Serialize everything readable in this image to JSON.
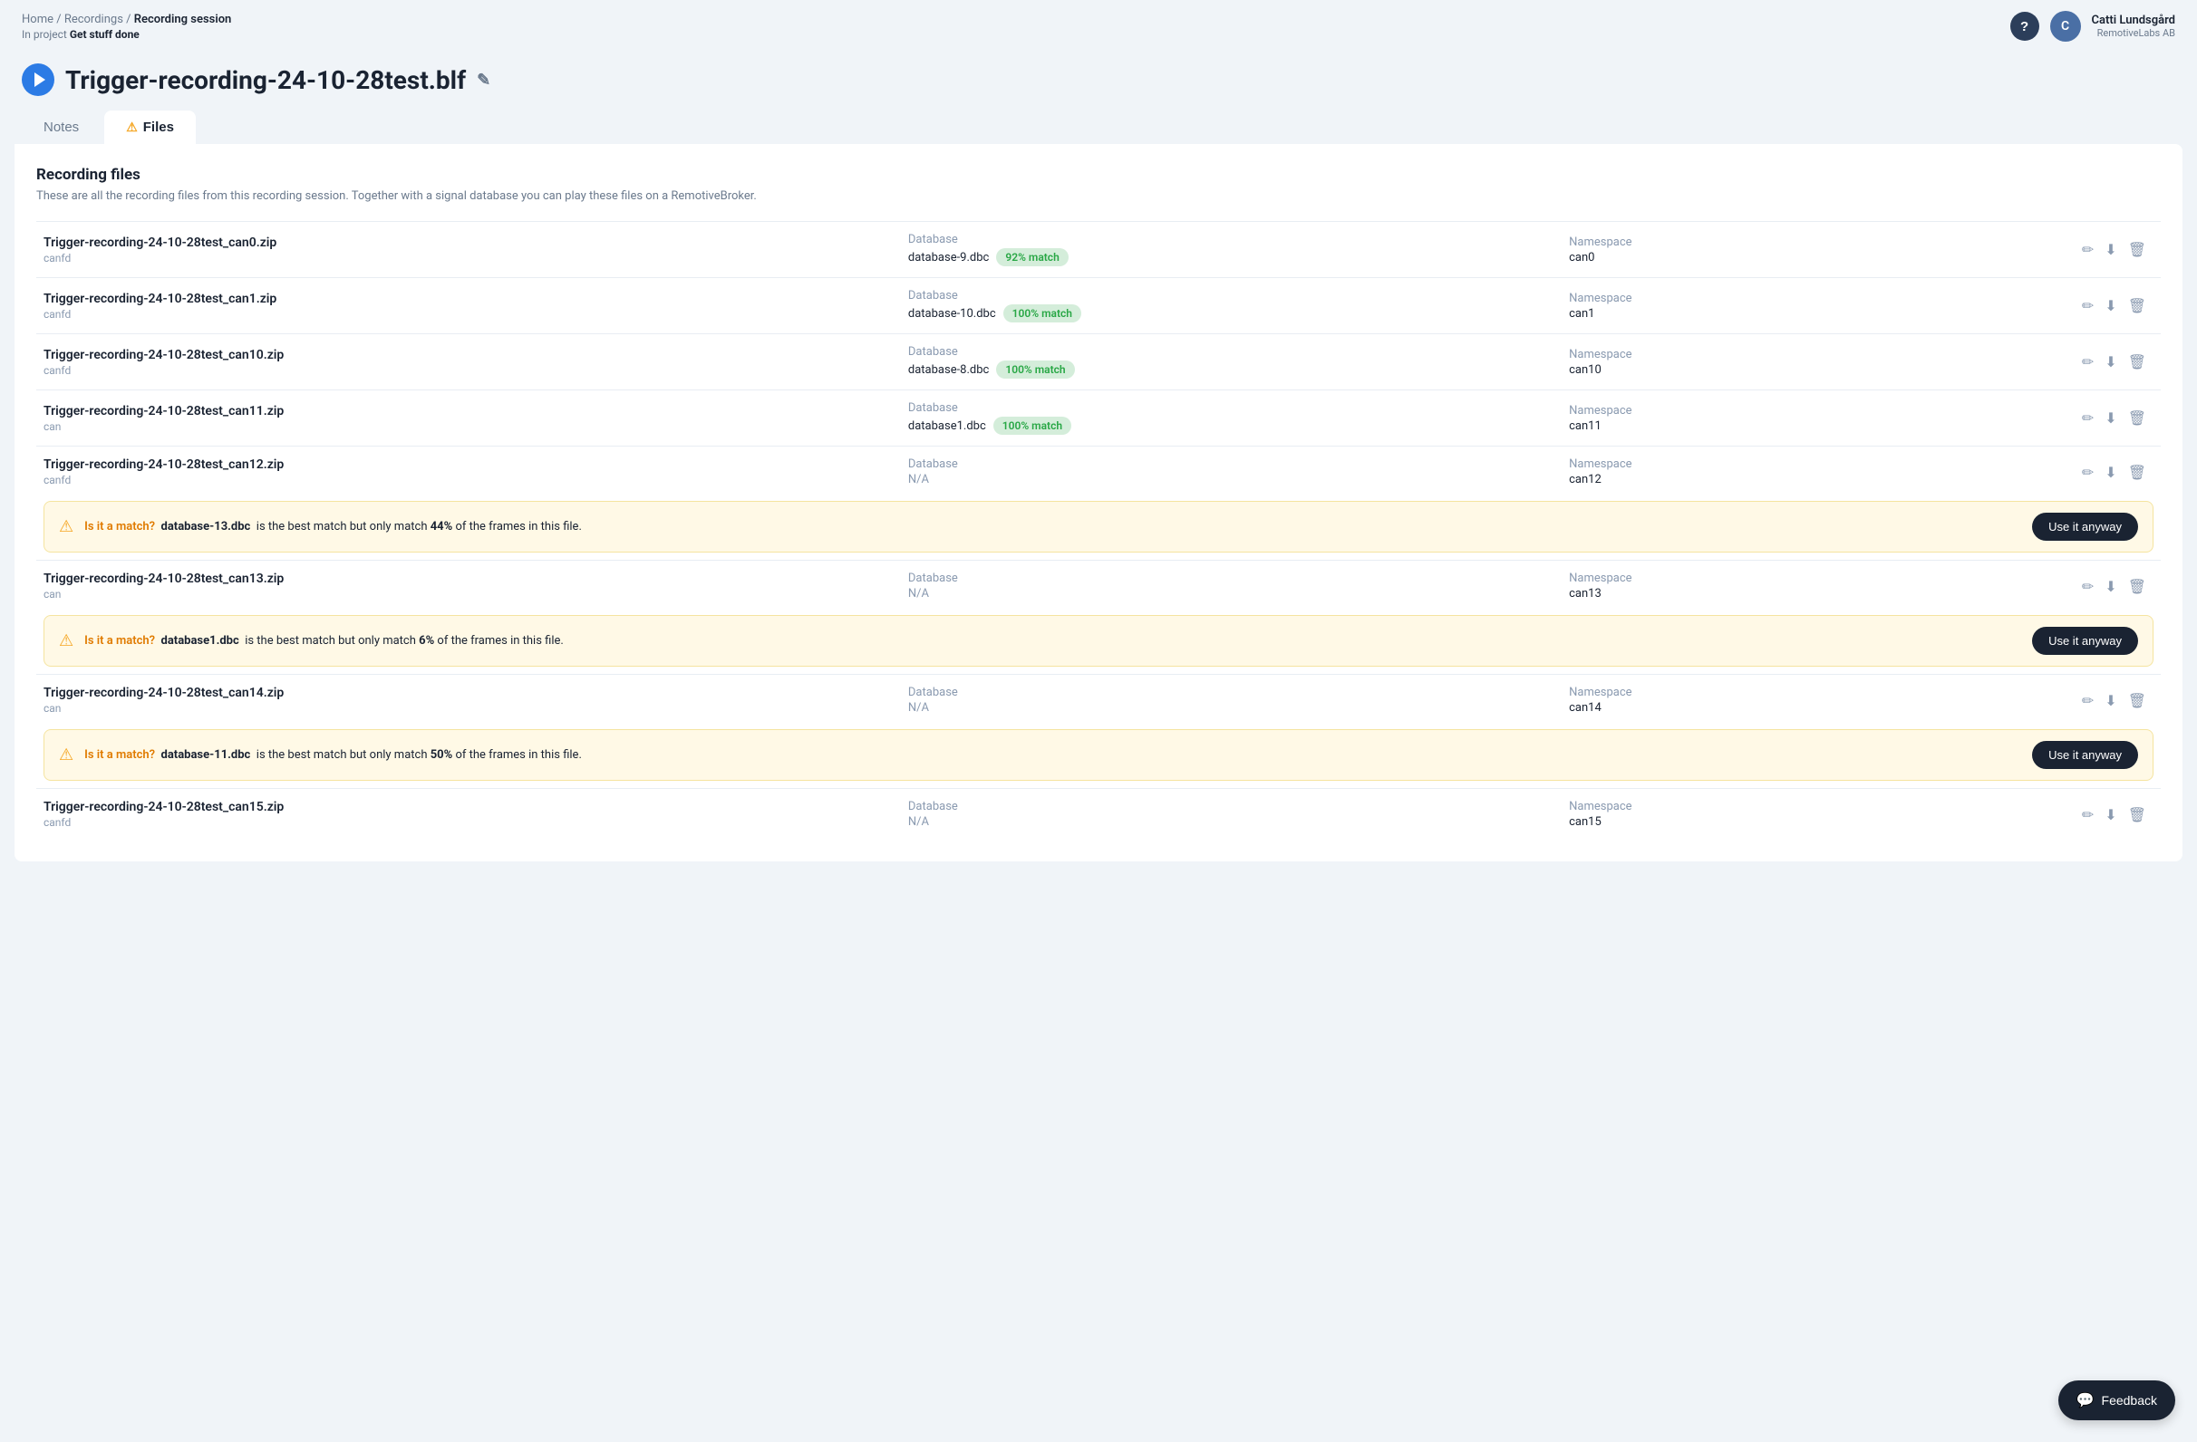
{
  "breadcrumb": {
    "home": "Home",
    "recordings": "Recordings",
    "current": "Recording session",
    "project_prefix": "In project",
    "project_name": "Get stuff done"
  },
  "user": {
    "name": "Catti Lundsgård",
    "company": "RemotiveLabs AB",
    "initials": "C"
  },
  "page": {
    "title": "Trigger-recording-24-10-28test.blf",
    "edit_icon": "✎"
  },
  "tabs": [
    {
      "id": "notes",
      "label": "Notes",
      "active": false,
      "warning": false
    },
    {
      "id": "files",
      "label": "Files",
      "active": true,
      "warning": true
    }
  ],
  "section": {
    "title": "Recording files",
    "description": "These are all the recording files from this recording session. Together with a signal database you can play these files on a RemotiveBroker."
  },
  "files": [
    {
      "name": "Trigger-recording-24-10-28test_can0.zip",
      "type": "canfd",
      "database_label": "Database",
      "database_value": "database-9.dbc",
      "match": "92% match",
      "match_class": "match-92",
      "namespace_label": "Namespace",
      "namespace_value": "can0",
      "has_warning": false
    },
    {
      "name": "Trigger-recording-24-10-28test_can1.zip",
      "type": "canfd",
      "database_label": "Database",
      "database_value": "database-10.dbc",
      "match": "100% match",
      "match_class": "match-100",
      "namespace_label": "Namespace",
      "namespace_value": "can1",
      "has_warning": false
    },
    {
      "name": "Trigger-recording-24-10-28test_can10.zip",
      "type": "canfd",
      "database_label": "Database",
      "database_value": "database-8.dbc",
      "match": "100% match",
      "match_class": "match-100",
      "namespace_label": "Namespace",
      "namespace_value": "can10",
      "has_warning": false
    },
    {
      "name": "Trigger-recording-24-10-28test_can11.zip",
      "type": "can",
      "database_label": "Database",
      "database_value": "database1.dbc",
      "match": "100% match",
      "match_class": "match-100",
      "namespace_label": "Namespace",
      "namespace_value": "can11",
      "has_warning": false
    },
    {
      "name": "Trigger-recording-24-10-28test_can12.zip",
      "type": "canfd",
      "database_label": "Database",
      "database_value": "N/A",
      "match": null,
      "match_class": null,
      "namespace_label": "Namespace",
      "namespace_value": "can12",
      "has_warning": true,
      "warning": {
        "best_match_db": "database-13.dbc",
        "match_percent": "44%",
        "button_label": "Use it anyway"
      }
    },
    {
      "name": "Trigger-recording-24-10-28test_can13.zip",
      "type": "can",
      "database_label": "Database",
      "database_value": "N/A",
      "match": null,
      "match_class": null,
      "namespace_label": "Namespace",
      "namespace_value": "can13",
      "has_warning": true,
      "warning": {
        "best_match_db": "database1.dbc",
        "match_percent": "6%",
        "button_label": "Use it anyway"
      }
    },
    {
      "name": "Trigger-recording-24-10-28test_can14.zip",
      "type": "can",
      "database_label": "Database",
      "database_value": "N/A",
      "match": null,
      "match_class": null,
      "namespace_label": "Namespace",
      "namespace_value": "can14",
      "has_warning": true,
      "warning": {
        "best_match_db": "database-11.dbc",
        "match_percent": "50%",
        "button_label": "Use it anyway"
      }
    },
    {
      "name": "Trigger-recording-24-10-28test_can15.zip",
      "type": "canfd",
      "database_label": "Database",
      "database_value": "N/A",
      "match": null,
      "match_class": null,
      "namespace_label": "Namespace",
      "namespace_value": "can15",
      "has_warning": false
    }
  ],
  "warning_text": {
    "is_match": "Is it a match?",
    "middle": "is the best match but only match",
    "end": "of the frames in this file."
  },
  "feedback": {
    "label": "Feedback",
    "icon": "💬"
  },
  "help": {
    "label": "?"
  }
}
